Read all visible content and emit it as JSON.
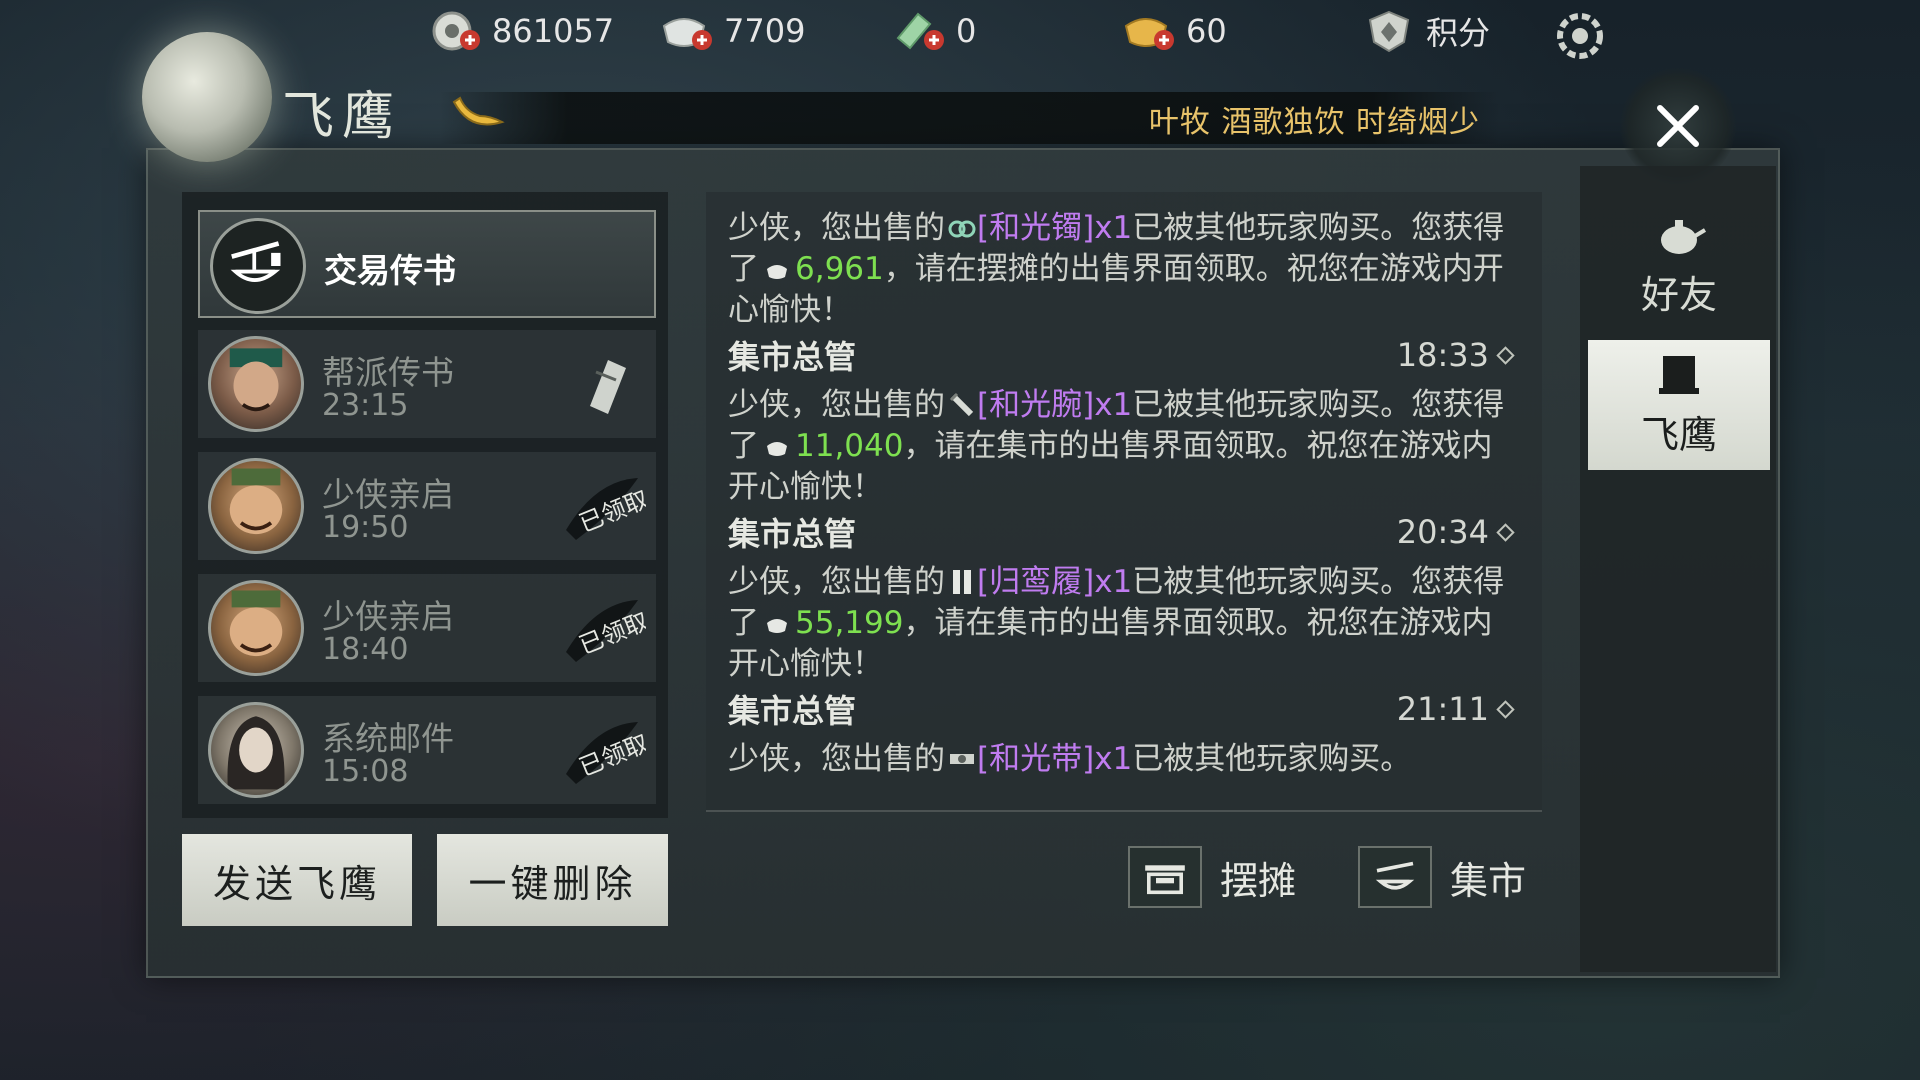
{
  "currencies": [
    {
      "icon": "gold-coin-plus-icon",
      "value": "861057"
    },
    {
      "icon": "silver-ingot-plus-icon",
      "value": "7709"
    },
    {
      "icon": "jade-ticket-plus-icon",
      "value": "0"
    },
    {
      "icon": "gold-ingot-plus-icon",
      "value": "60"
    },
    {
      "icon": "points-badge-icon",
      "value": "积分"
    }
  ],
  "header": {
    "title": "飞鹰",
    "marquee": "叶牧 酒歌独饮 时绮烟少"
  },
  "mail_list": [
    {
      "name": "交易传书",
      "time": "",
      "status": "active",
      "avatar": "trade-scale-icon"
    },
    {
      "name": "帮派传书",
      "time": "23:15",
      "status": "unread",
      "avatar": "guild-official-avatar"
    },
    {
      "name": "少侠亲启",
      "time": "19:50",
      "status": "已领取",
      "avatar": "merchant-avatar"
    },
    {
      "name": "少侠亲启",
      "time": "18:40",
      "status": "已领取",
      "avatar": "merchant-avatar"
    },
    {
      "name": "系统邮件",
      "time": "15:08",
      "status": "已领取",
      "avatar": "system-lady-avatar"
    }
  ],
  "buttons": {
    "send": "发送飞鹰",
    "delete_all": "一键删除",
    "stall": "摆摊",
    "market": "集市"
  },
  "messages": [
    {
      "sender": "",
      "time": "",
      "prefix": "少侠，您出售的",
      "item": "[和光镯]x1",
      "mid": "已被其他玩家购买。您获得了",
      "amount": "6,961",
      "suffix": "，请在摆摊的出售界面领取。祝您在游戏内开心愉快！"
    },
    {
      "sender": "集市总管",
      "time": "18:33",
      "prefix": "少侠，您出售的",
      "item": "[和光腕]x1",
      "mid": "已被其他玩家购买。您获得了",
      "amount": "11,040",
      "suffix": "，请在集市的出售界面领取。祝您在游戏内开心愉快！"
    },
    {
      "sender": "集市总管",
      "time": "20:34",
      "prefix": "少侠，您出售的",
      "item": "[归鸾履]x1",
      "mid": "已被其他玩家购买。您获得了",
      "amount": "55,199",
      "suffix": "，请在集市的出售界面领取。祝您在游戏内开心愉快！"
    },
    {
      "sender": "集市总管",
      "time": "21:11",
      "prefix": "少侠，您出售的",
      "item": "[和光带]x1",
      "mid": "已被其他玩家购买。",
      "amount": "",
      "suffix": ""
    }
  ],
  "side_tabs": [
    {
      "label": "好友",
      "icon": "teapot-icon",
      "active": false
    },
    {
      "label": "飞鹰",
      "icon": "scroll-icon",
      "active": true
    }
  ],
  "colors": {
    "item": "#c07cf0",
    "money": "#7ee050",
    "marquee": "#e8c36a"
  }
}
